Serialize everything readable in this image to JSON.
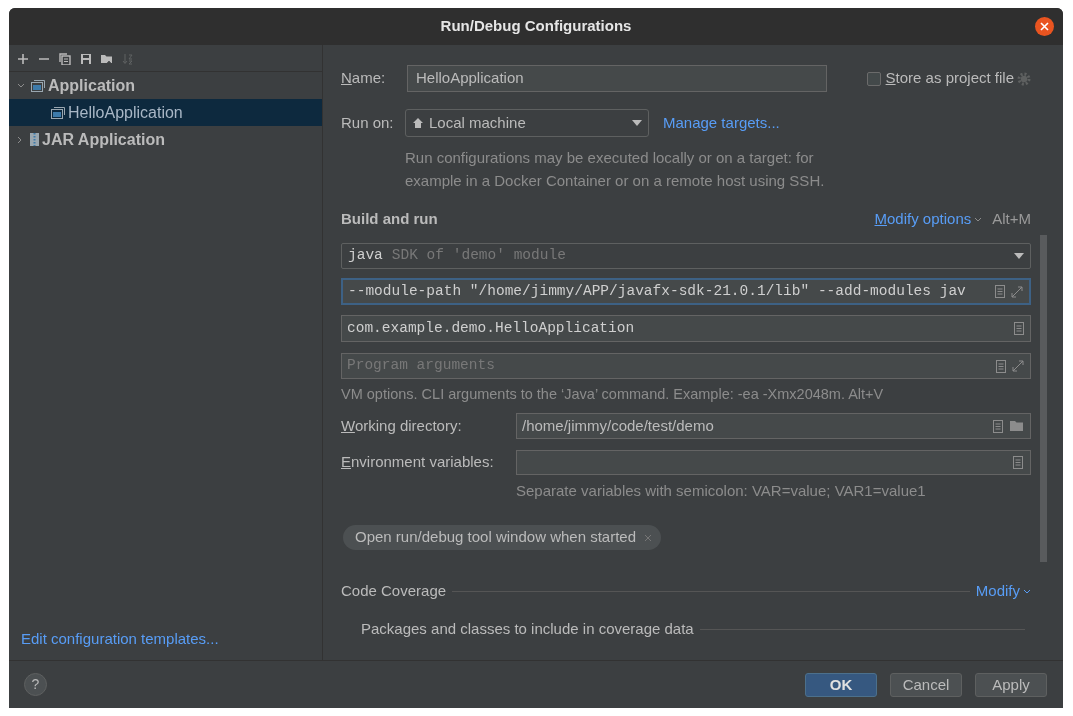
{
  "window": {
    "title": "Run/Debug Configurations"
  },
  "toolbar": [
    {
      "kind": "add",
      "disabled": false
    },
    {
      "kind": "remove",
      "disabled": false
    },
    {
      "kind": "copy",
      "disabled": false
    },
    {
      "kind": "save",
      "disabled": false
    },
    {
      "kind": "folder",
      "disabled": false
    },
    {
      "kind": "sort",
      "disabled": true
    }
  ],
  "tree": [
    {
      "label": "Application",
      "kind": "app",
      "expanded": true,
      "selected": false,
      "children": [
        {
          "label": "HelloApplication",
          "kind": "app",
          "selected": true
        }
      ]
    },
    {
      "label": "JAR Application",
      "kind": "jar",
      "expanded": false,
      "selected": false
    }
  ],
  "templates_link": "Edit configuration templates...",
  "name": {
    "label": "Name:",
    "mnemonic": true,
    "value": "HelloApplication"
  },
  "store_as_project_file": {
    "label": "Store as project file",
    "mnemonic": true,
    "checked": false
  },
  "run_on": {
    "label": "Run on:",
    "value": "Local machine",
    "link": "Manage targets...",
    "hint": "Run configurations may be executed locally or on a target: for example in a Docker Container or on a remote host using SSH."
  },
  "build_and_run": {
    "title": "Build and run",
    "modify": {
      "label": "Modify options",
      "mnemonic": true
    },
    "shortcut": "Alt+M",
    "sdk": {
      "value": "java",
      "hint": "SDK of 'demo' module"
    },
    "vm_options": {
      "value": "--module-path \"/home/jimmy/APP/javafx-sdk-21.0.1/lib\" --add-modules jav",
      "focused": true
    },
    "main_class": {
      "value": "com.example.demo.HelloApplication"
    },
    "program_arguments": {
      "placeholder": "Program arguments"
    },
    "vm_hint": "VM options. CLI arguments to the ‘Java’ command. Example: -ea -Xmx2048m. Alt+V"
  },
  "working_directory": {
    "label": "Working directory:",
    "mnemonic": true,
    "value": "/home/jimmy/code/test/demo"
  },
  "environment_variables": {
    "label": "Environment variables:",
    "mnemonic": true,
    "hint": "Separate variables with semicolon: VAR=value; VAR1=value1"
  },
  "chips": [
    {
      "label": "Open run/debug tool window when started"
    }
  ],
  "code_coverage": {
    "title": "Code Coverage",
    "modify": "Modify",
    "packages": "Packages and classes to include in coverage data"
  },
  "buttons": [
    {
      "label": "OK",
      "kind": "primary"
    },
    {
      "label": "Cancel",
      "kind": "secondary"
    },
    {
      "label": "Apply",
      "kind": "secondary"
    }
  ],
  "help": "?"
}
